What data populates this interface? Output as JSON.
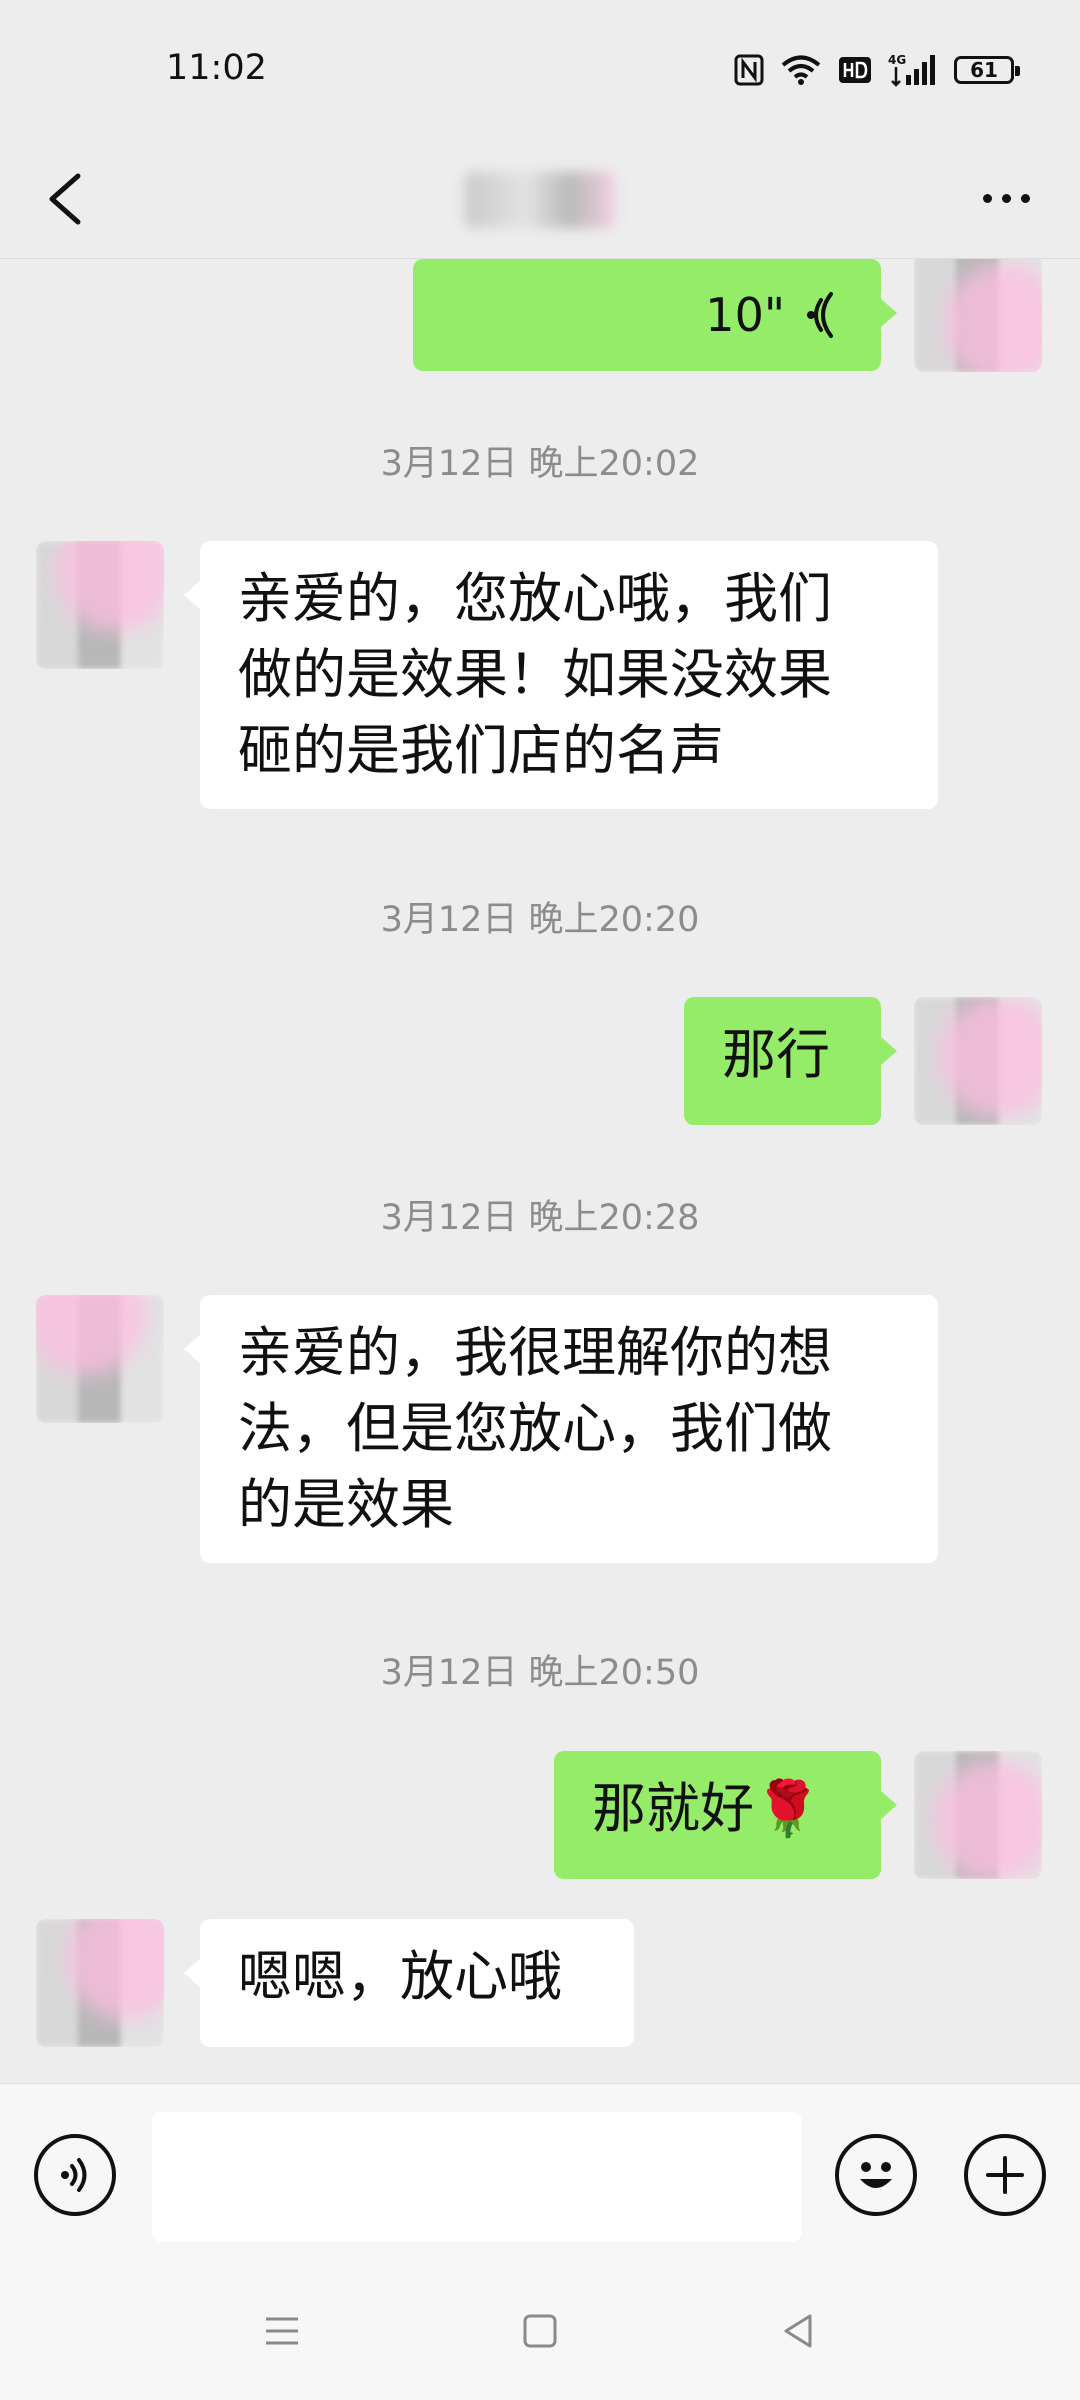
{
  "status_bar": {
    "time": "11:02",
    "battery": "61",
    "icons": [
      "nfc-icon",
      "wifi-icon",
      "hd-icon",
      "signal-4g-icon",
      "battery-icon"
    ]
  },
  "header": {
    "back_icon": "chevron-left-icon",
    "more_icon": "more-icon"
  },
  "messages": [
    {
      "type": "voice",
      "direction": "out",
      "duration": "10\""
    },
    {
      "type": "timestamp",
      "text": "3月12日 晚上20:02"
    },
    {
      "type": "text",
      "direction": "in",
      "lines": [
        "亲爱的，您放心哦，我们",
        "做的是效果！如果没效果",
        "砸的是我们店的名声"
      ]
    },
    {
      "type": "timestamp",
      "text": "3月12日 晚上20:20"
    },
    {
      "type": "text",
      "direction": "out",
      "text": "那行"
    },
    {
      "type": "timestamp",
      "text": "3月12日 晚上20:28"
    },
    {
      "type": "text",
      "direction": "in",
      "lines": [
        "亲爱的，我很理解你的想",
        "法，但是您放心，我们做",
        "的是效果"
      ]
    },
    {
      "type": "timestamp",
      "text": "3月12日 晚上20:50"
    },
    {
      "type": "text",
      "direction": "out",
      "text": "那就好🌹"
    },
    {
      "type": "text",
      "direction": "in",
      "text": "嗯嗯，放心哦"
    }
  ],
  "input_bar": {
    "voice_icon": "voice-input-icon",
    "text_value": "",
    "emoji_icon": "emoji-icon",
    "plus_icon": "plus-icon"
  },
  "nav_bar": {
    "icons": [
      "menu-icon",
      "home-square-icon",
      "back-triangle-icon"
    ]
  }
}
